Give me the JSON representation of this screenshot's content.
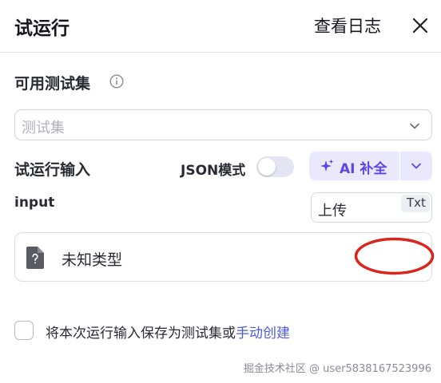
{
  "header": {
    "title": "试运行",
    "log_link": "查看日志",
    "close_icon": "close-icon"
  },
  "testset": {
    "label": "可用测试集",
    "info_icon": "info-icon",
    "placeholder": "测试集",
    "chevron_icon": "chevron-down-icon"
  },
  "run_input": {
    "label": "试运行输入",
    "json_mode_label": "JSON模式",
    "json_mode_on": false,
    "ai_button_label": "AI 补全",
    "ai_icon": "sparkle-icon",
    "ai_dropdown_icon": "chevron-down-icon",
    "accent_color": "#5b47e8"
  },
  "field": {
    "name": "input",
    "upload_label": "上传",
    "type_badge": "Txt",
    "file_icon": "unknown-file-icon",
    "file_type": "未知类型"
  },
  "footer": {
    "save_text": "将本次运行输入保存为测试集或",
    "create_link": "手动创建",
    "save_checked": false
  },
  "watermark": "掘金技术社区 @ user5838167523996"
}
